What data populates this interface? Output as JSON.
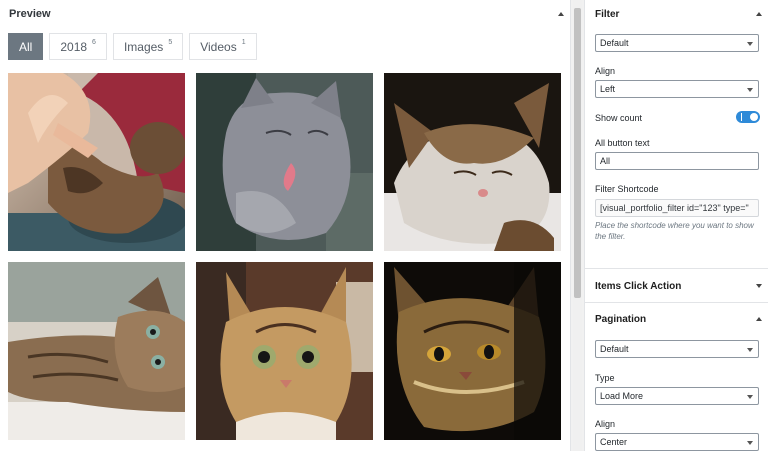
{
  "preview": {
    "title": "Preview",
    "filters": [
      {
        "label": "All",
        "count": "",
        "active": true
      },
      {
        "label": "2018",
        "count": "6",
        "active": false
      },
      {
        "label": "Images",
        "count": "5",
        "active": false
      },
      {
        "label": "Videos",
        "count": "1",
        "active": false
      }
    ],
    "gallery_items": [
      {
        "image": "cat-high-five"
      },
      {
        "image": "gray-cat-licking"
      },
      {
        "image": "sleeping-tabby-cat"
      },
      {
        "image": "lying-tabby-cat"
      },
      {
        "image": "bengal-cat-staring"
      },
      {
        "image": "tabby-cat-in-shadow"
      }
    ]
  },
  "sidebar": {
    "filter": {
      "title": "Filter",
      "select_value": "Default",
      "align_label": "Align",
      "align_value": "Left",
      "show_count_label": "Show count",
      "show_count_on": true,
      "all_button_label": "All button text",
      "all_button_value": "All",
      "shortcode_label": "Filter Shortcode",
      "shortcode_value": "[visual_portfolio_filter id=\"123\" type=\"",
      "shortcode_help": "Place the shortcode where you want to show the filter."
    },
    "items_click_action": {
      "title": "Items Click Action"
    },
    "pagination": {
      "title": "Pagination",
      "select_value": "Default",
      "type_label": "Type",
      "type_value": "Load More",
      "align_label": "Align",
      "align_value": "Center"
    }
  },
  "colors": {
    "accent": "#2e8ad8",
    "active_filter": "#6c7781"
  }
}
